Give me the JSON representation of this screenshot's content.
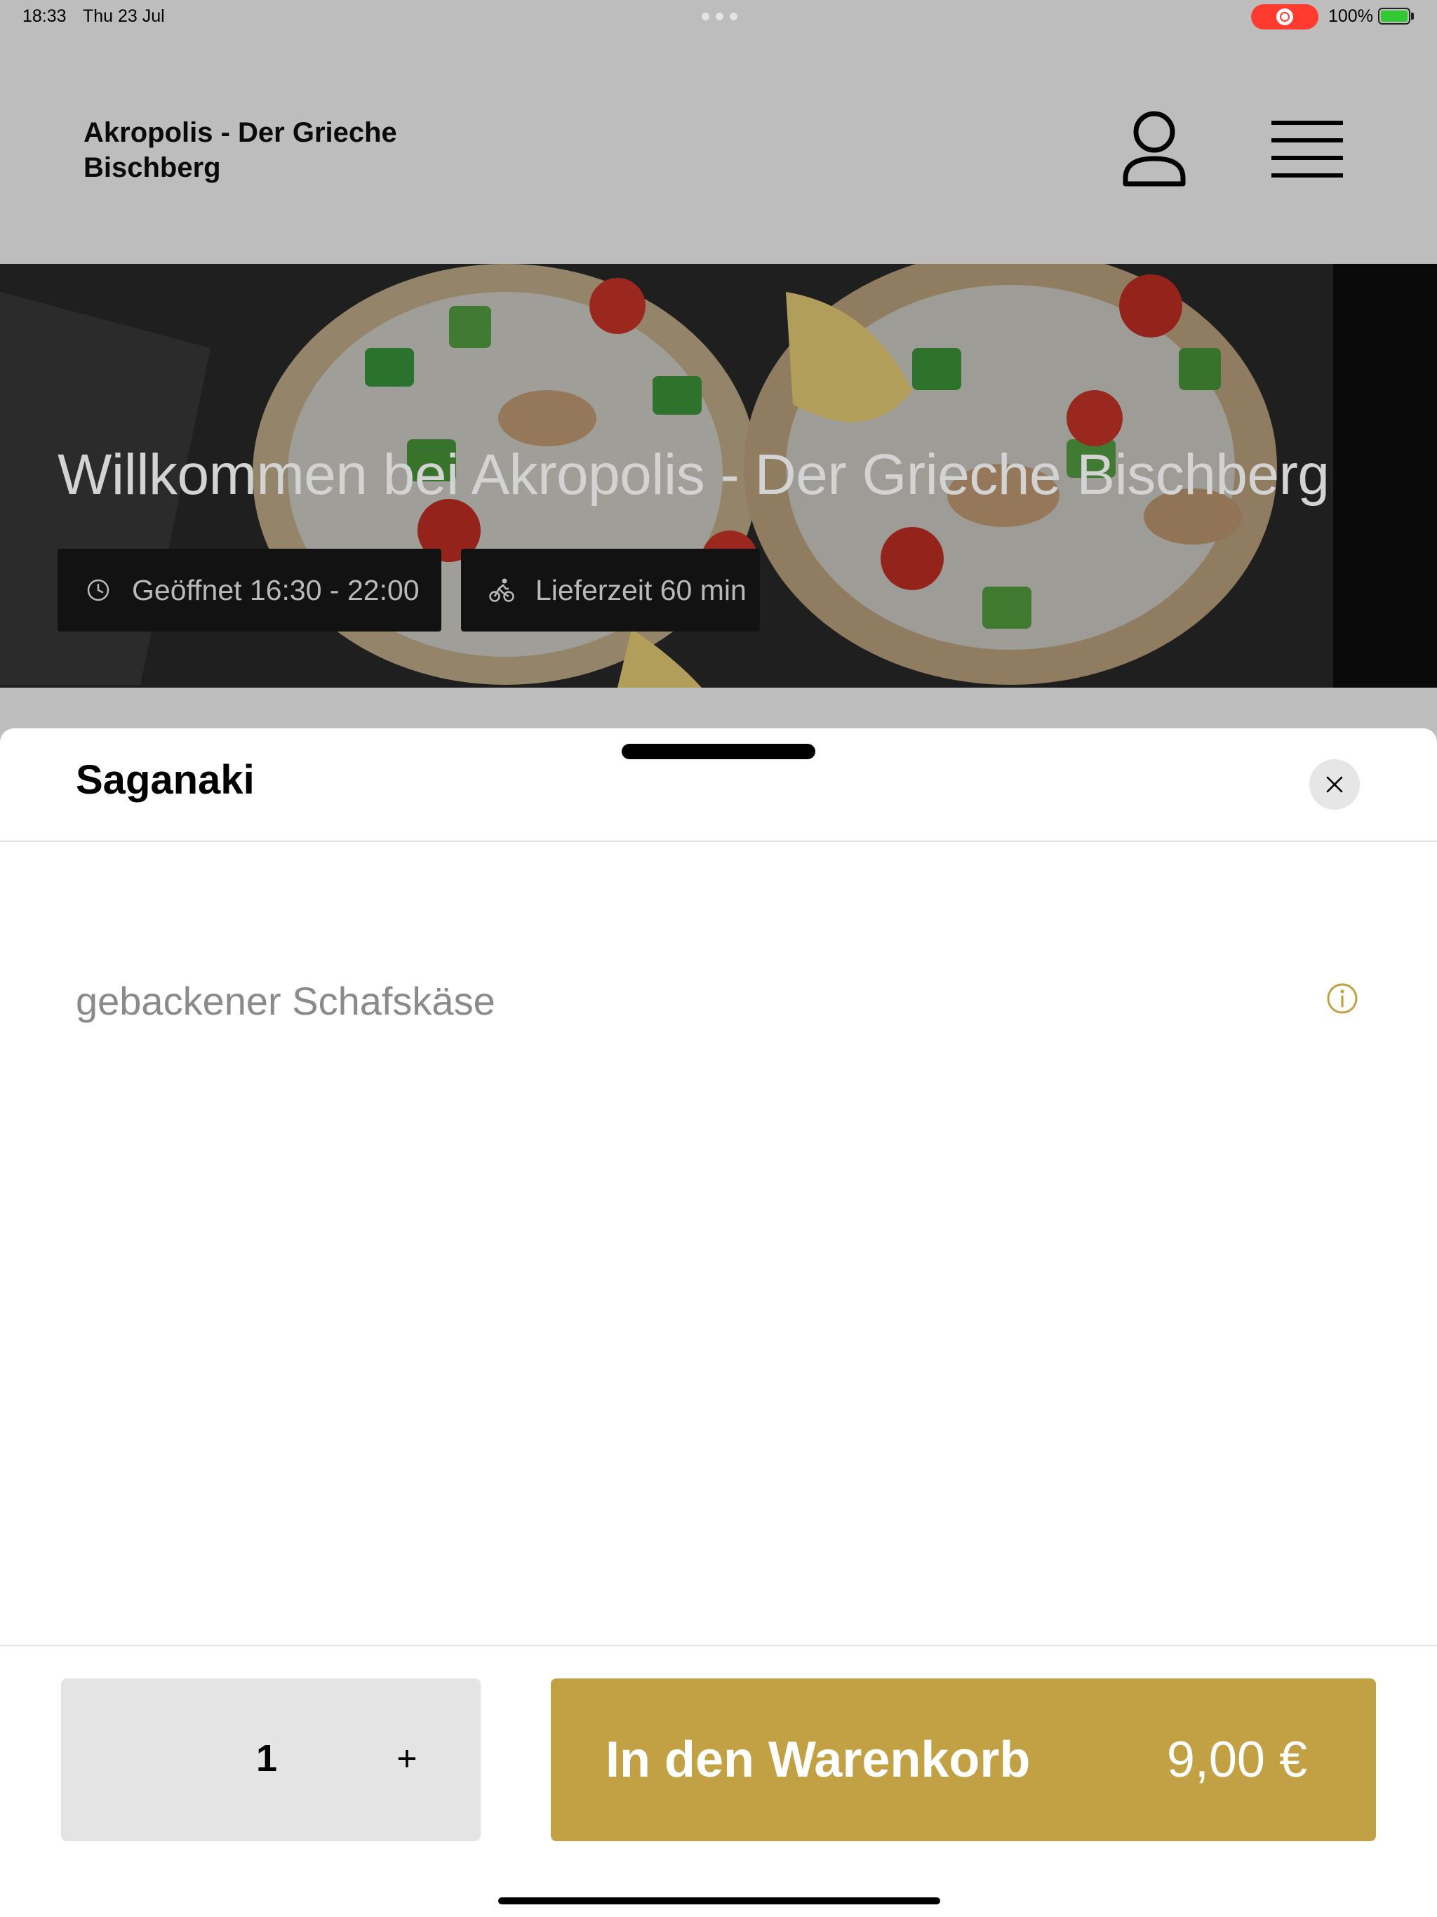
{
  "status_bar": {
    "time": "18:33",
    "date": "Thu 23 Jul",
    "battery": "100%"
  },
  "header": {
    "title": "Akropolis - Der Grieche Bischberg",
    "icons": [
      "user-icon",
      "menu-icon"
    ]
  },
  "hero": {
    "title": "Willkommen bei Akropolis - Der Grieche Bischberg",
    "opening_hours": "Geöffnet 16:30 - 22:00",
    "delivery_time": "Lieferzeit 60 min"
  },
  "item": {
    "name": "Saganaki",
    "description": "gebackener Schafskäse",
    "quantity": "1",
    "add_to_cart_label": "In den Warenkorb",
    "price": "9,00 €"
  },
  "colors": {
    "accent": "#c2a145",
    "status_recording": "#ff3b30",
    "battery": "#32c832"
  }
}
